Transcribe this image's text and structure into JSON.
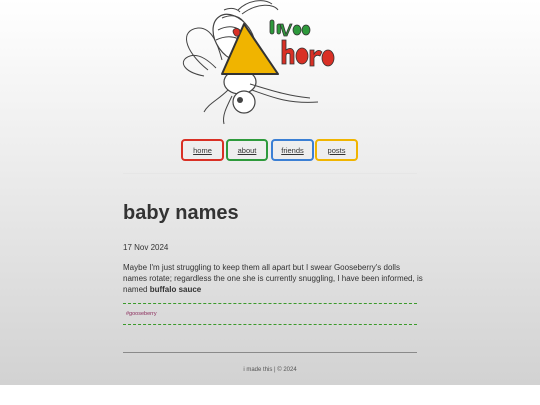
{
  "nav": {
    "home": "home",
    "about": "about",
    "friends": "friends",
    "posts": "posts"
  },
  "post": {
    "title": "baby names",
    "date": "17 Nov 2024",
    "body": "Maybe I'm just struggling to keep them all apart but I swear Gooseberry's dolls names rotate; regardless the one she is currently snuggling, I have been informed, is named ",
    "body_bold": "buffalo sauce",
    "tag": "#gooseberry"
  },
  "footer": {
    "text": "i made this | © 2024"
  },
  "logo": {
    "icon": "wasp-logo-icon",
    "colors": {
      "red": "#d93025",
      "green": "#2e9a3c",
      "blue": "#3b7fd4",
      "yellow": "#f0b400"
    }
  }
}
